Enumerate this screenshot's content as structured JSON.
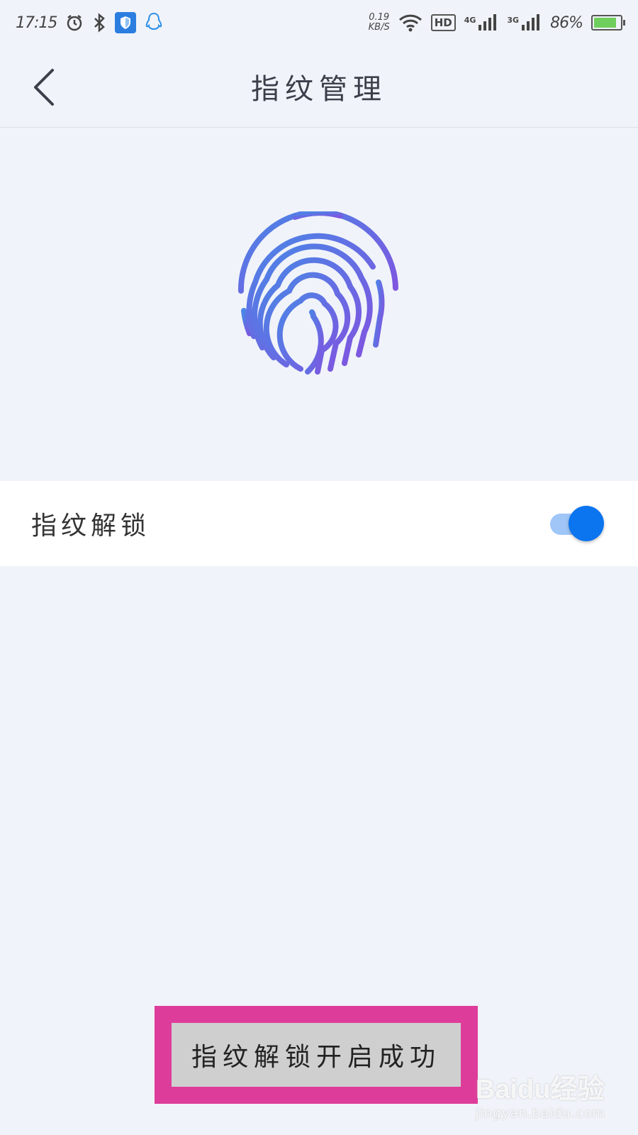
{
  "status_bar": {
    "time": "17:15",
    "net_speed_value": "0.19",
    "net_speed_unit": "KB/S",
    "hd_label": "HD",
    "signal_1_label": "4G",
    "signal_2_label": "3G",
    "battery_percent": "86%",
    "battery_level": 0.86
  },
  "header": {
    "title": "指纹管理"
  },
  "settings": {
    "fingerprint_unlock_label": "指纹解锁",
    "fingerprint_unlock_enabled": true
  },
  "toast": {
    "message": "指纹解锁开启成功"
  },
  "watermark": {
    "logo": "Baidu经验",
    "url": "jingyan.baidu.com"
  },
  "colors": {
    "accent": "#0b74ef",
    "highlight": "#de3c9a",
    "fingerprint_start": "#4a7fe6",
    "fingerprint_end": "#7a5ae0"
  }
}
